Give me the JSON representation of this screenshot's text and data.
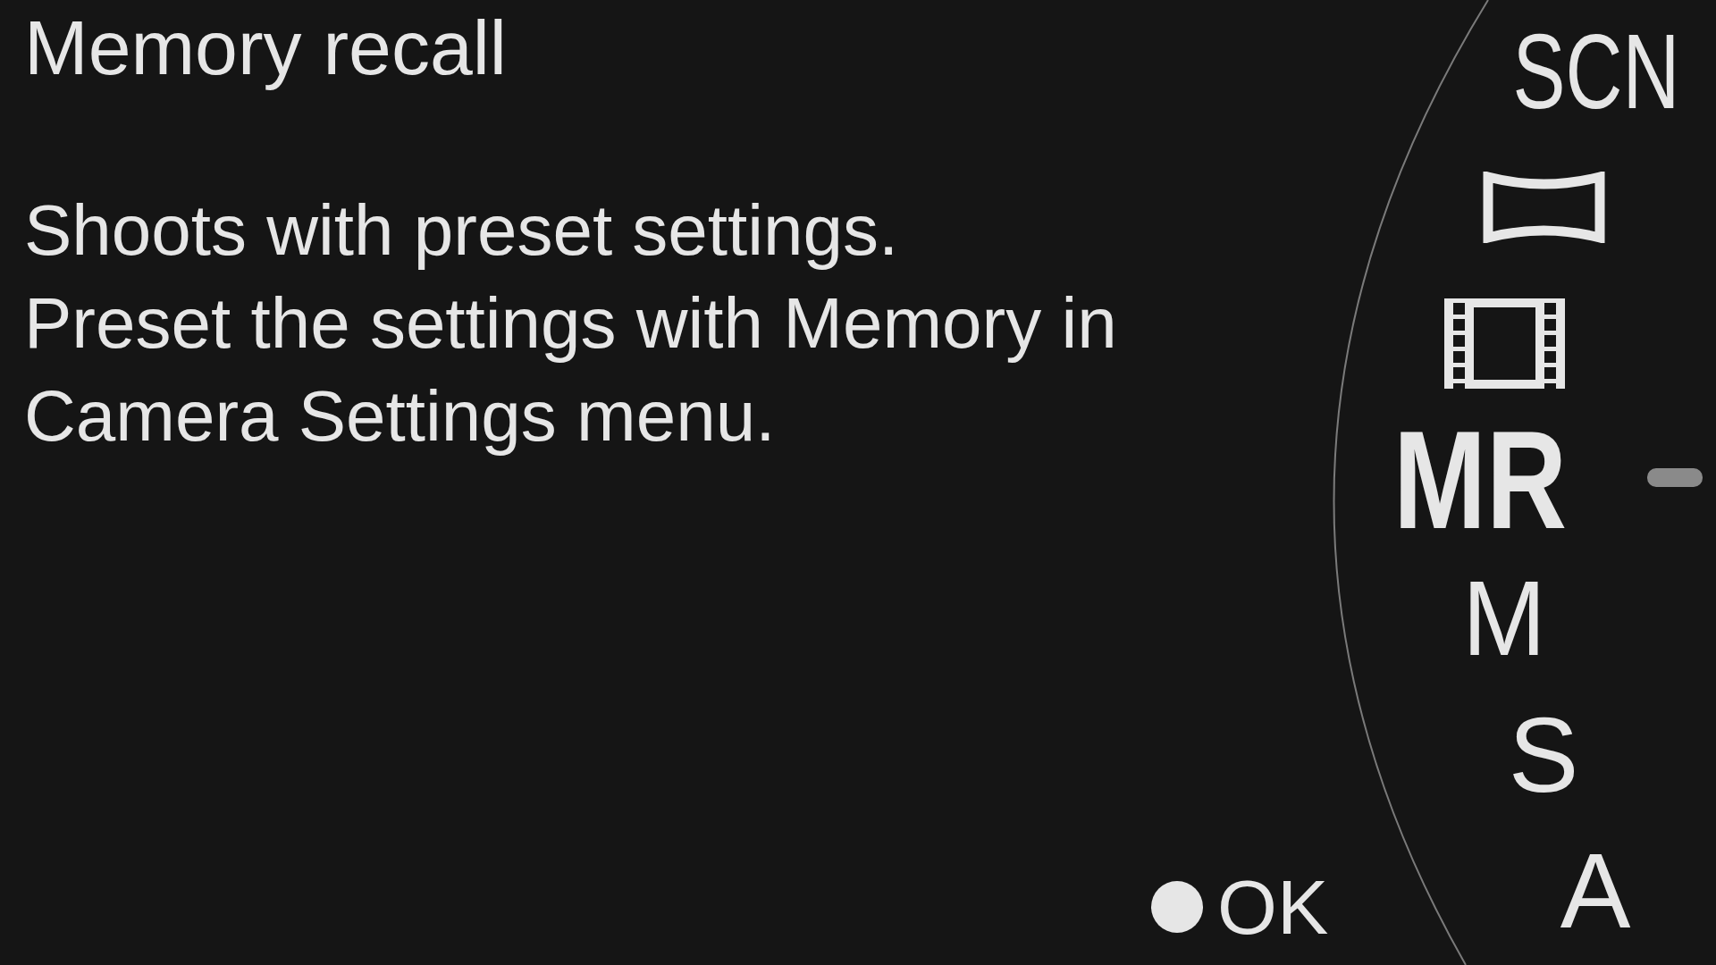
{
  "title": "Memory recall",
  "description": [
    "Shoots with preset settings.",
    "Preset the settings with Memory in",
    "Camera Settings menu."
  ],
  "confirm": {
    "label": "OK"
  },
  "dial": [
    {
      "kind": "text",
      "label": "SCN",
      "selected": false
    },
    {
      "kind": "panorama",
      "selected": false
    },
    {
      "kind": "movie",
      "selected": false
    },
    {
      "kind": "text",
      "label": "MR",
      "selected": true
    },
    {
      "kind": "text",
      "label": "M",
      "selected": false
    },
    {
      "kind": "text",
      "label": "S",
      "selected": false
    },
    {
      "kind": "text",
      "label": "A",
      "selected": false
    }
  ]
}
